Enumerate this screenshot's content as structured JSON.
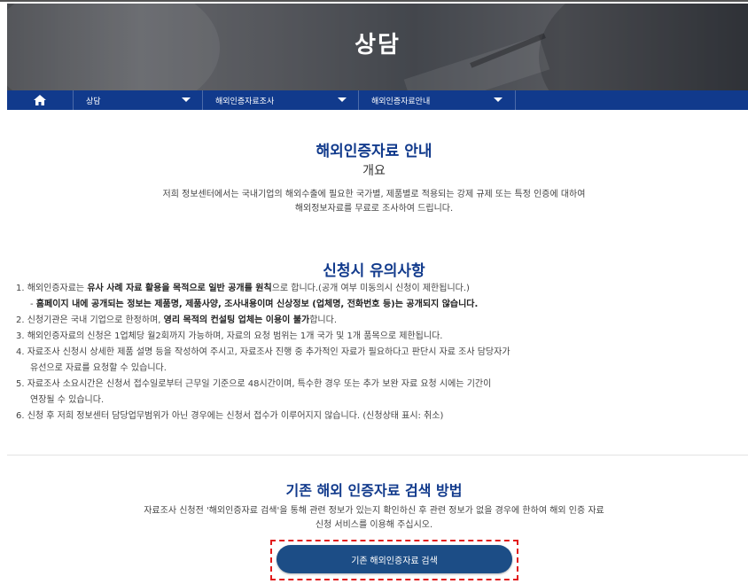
{
  "banner": {
    "title": "상담"
  },
  "nav": {
    "home_icon": "home-icon",
    "items": [
      {
        "label": "상담"
      },
      {
        "label": "해외인증자료조사"
      },
      {
        "label": "해외인증자료안내"
      }
    ]
  },
  "intro": {
    "title": "해외인증자료 안내",
    "subtitle": "개요",
    "lines": [
      "저희 정보센터에서는 국내기업의 해외수출에 필요한 국가별, 제품별로 적용되는 강제 규제 또는 특정 인증에 대하여",
      "해외정보자료를 무료로 조사하여 드립니다."
    ]
  },
  "notice": {
    "title": "신청시 유의사항",
    "items": [
      {
        "pre": "1. 해외인증자료는 ",
        "bold": "유사 사례 자료 활용을 목적으로 일반 공개를 원칙",
        "post": "으로 합니다.(공개 여부 미동의시 신청이 제한됩니다.)"
      },
      {
        "pre": "- ",
        "bold": "홈페이지 내에 공개되는 정보는 제품명, 제품사양, 조사내용이며 신상정보 (업체명, 전화번호 등)는 공개되지 않습니다.",
        "post": ""
      },
      {
        "pre": "2. 신청기관은 국내 기업으로 한정하며, ",
        "bold": "영리 목적의 컨설팅 업체는 이용이 불가",
        "post": "합니다."
      },
      {
        "pre": "3. 해외인증자료의 신청은 1업체당 월2회까지 가능하며, 자료의 요청 범위는 1개 국가 및 1개 품목으로 제한됩니다.",
        "bold": "",
        "post": ""
      },
      {
        "pre": "4. 자료조사 신청시 상세한 제품 설명 등을 작성하여 주시고, 자료조사 진행 중 추가적인 자료가 필요하다고 판단시 자료 조사 담당자가",
        "bold": "",
        "post": ""
      },
      {
        "pre": "유선으로 자료를 요청할 수 있습니다.",
        "bold": "",
        "post": ""
      },
      {
        "pre": "5. 자료조사 소요시간은 신청서 접수일로부터 근무일 기준으로 48시간이며, 특수한 경우 또는 추가 보완 자료 요청 시에는 기간이",
        "bold": "",
        "post": ""
      },
      {
        "pre": "연장될 수 있습니다.",
        "bold": "",
        "post": ""
      },
      {
        "pre": "6. 신청 후 저희 정보센터 담당업무범위가 아닌 경우에는 신청서 접수가 이루어지지 않습니다. (신청상태 표시: 취소)",
        "bold": "",
        "post": ""
      }
    ]
  },
  "search": {
    "title": "기존 해외 인증자료 검색 방법",
    "lines": [
      "자료조사 신청전 '해외인증자료 검색'을 통해 관련 정보가 있는지 확인하신 후 관련 정보가 없을 경우에 한하여 해외 인증 자료",
      "신청 서비스를 이용해 주십시오."
    ],
    "button_label": "기존 해외인증자료 검색"
  },
  "colors": {
    "nav_bg": "#113a8c",
    "title": "#113a8c",
    "button_bg": "#1c4d86",
    "highlight": "#e21c1c"
  }
}
